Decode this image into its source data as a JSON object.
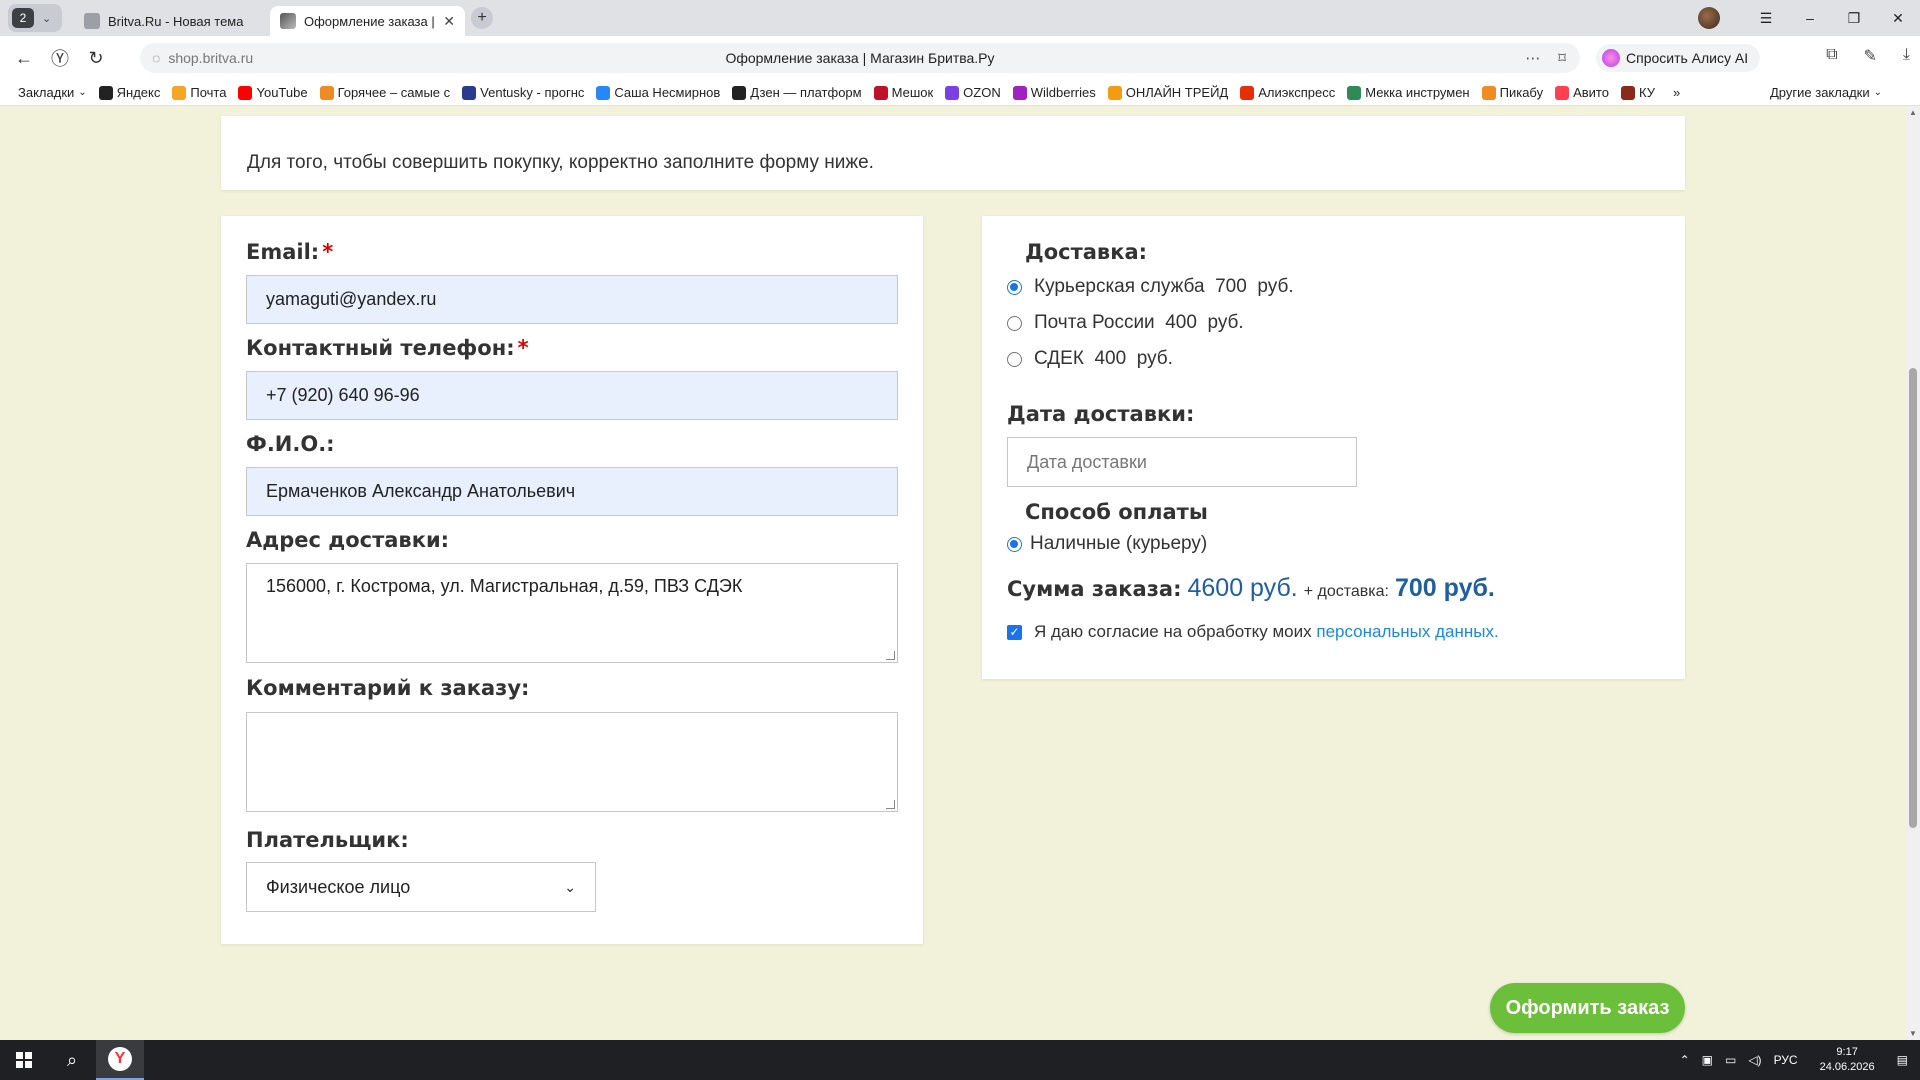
{
  "browser": {
    "tab_count": "2",
    "tabs": [
      {
        "title": "Britva.Ru - Новая тема"
      },
      {
        "title": "Оформление заказа | М"
      }
    ],
    "url": "shop.britva.ru",
    "page_title": "Оформление заказа | Магазин Бритва.Ру",
    "alice_label": "Спросить Алису AI",
    "bookmarks_label": "Закладки",
    "bookmarks": [
      {
        "label": "Яндекс",
        "color": "#222222"
      },
      {
        "label": "Почта",
        "color": "#f5a623"
      },
      {
        "label": "YouTube",
        "color": "#ff0000"
      },
      {
        "label": "Горячее – самые с",
        "color": "#f08a24"
      },
      {
        "label": "Ventusky - прогнс",
        "color": "#2a3b8f"
      },
      {
        "label": "Саша Несмирнов",
        "color": "#2787f5"
      },
      {
        "label": "Дзен — платформ",
        "color": "#222222"
      },
      {
        "label": "Мешок",
        "color": "#c0102a"
      },
      {
        "label": "OZON",
        "color": "#7b3fe4"
      },
      {
        "label": "Wildberries",
        "color": "#a020c0"
      },
      {
        "label": "ОНЛАЙН ТРЕЙД",
        "color": "#f39c12"
      },
      {
        "label": "Алиэкспресс",
        "color": "#e62e04"
      },
      {
        "label": "Мекка инструмен",
        "color": "#2e8b57"
      },
      {
        "label": "Пикабу",
        "color": "#f08a24"
      },
      {
        "label": "Авито",
        "color": "#ff4053"
      },
      {
        "label": "КУ",
        "color": "#8b2a1a"
      }
    ],
    "more_label": "»",
    "other_bookmarks": "Другие закладки"
  },
  "intro_text": "Для того, чтобы совершить покупку, корректно заполните форму ниже.",
  "form": {
    "email_label": "Email:",
    "email_value": "yamaguti@yandex.ru",
    "phone_label": "Контактный телефон:",
    "phone_value": "+7 (920) 640 96-96",
    "name_label": "Ф.И.О.:",
    "name_value": "Ермаченков Александр Анатольевич",
    "address_label": "Адрес доставки:",
    "address_value": "156000, г. Кострома, ул. Магистральная, д.59, ПВЗ СДЭК",
    "comment_label": "Комментарий к заказу:",
    "comment_value": "",
    "payer_label": "Плательщик:",
    "payer_value": "Физическое лицо",
    "required_mark": "*"
  },
  "delivery": {
    "title": "Доставка:",
    "options": [
      {
        "label": "Курьерская служба  700  руб.",
        "checked": true
      },
      {
        "label": "Почта России  400  руб.",
        "checked": false
      },
      {
        "label": "СДЕК  400  руб.",
        "checked": false
      }
    ],
    "date_label": "Дата доставки:",
    "date_placeholder": "Дата доставки",
    "payment_title": "Способ оплаты",
    "payment_option": "Наличные (курьеру)",
    "sum_label": "Сумма заказа:",
    "sum_value": "4600 руб.",
    "plus_delivery": "+ доставка:",
    "delivery_value": "700 руб.",
    "consent_text": "Я даю согласие на обработку моих",
    "consent_link": "персональных данных."
  },
  "submit_label": "Оформить заказ",
  "taskbar": {
    "lang": "РУС",
    "time": "9:17",
    "date": "24.06.2026"
  },
  "colors": {
    "page_bg": "#f2f2da",
    "accent_blue": "#1f5f9f",
    "button_green": "#6cbf3a",
    "required_red": "#d00000"
  }
}
